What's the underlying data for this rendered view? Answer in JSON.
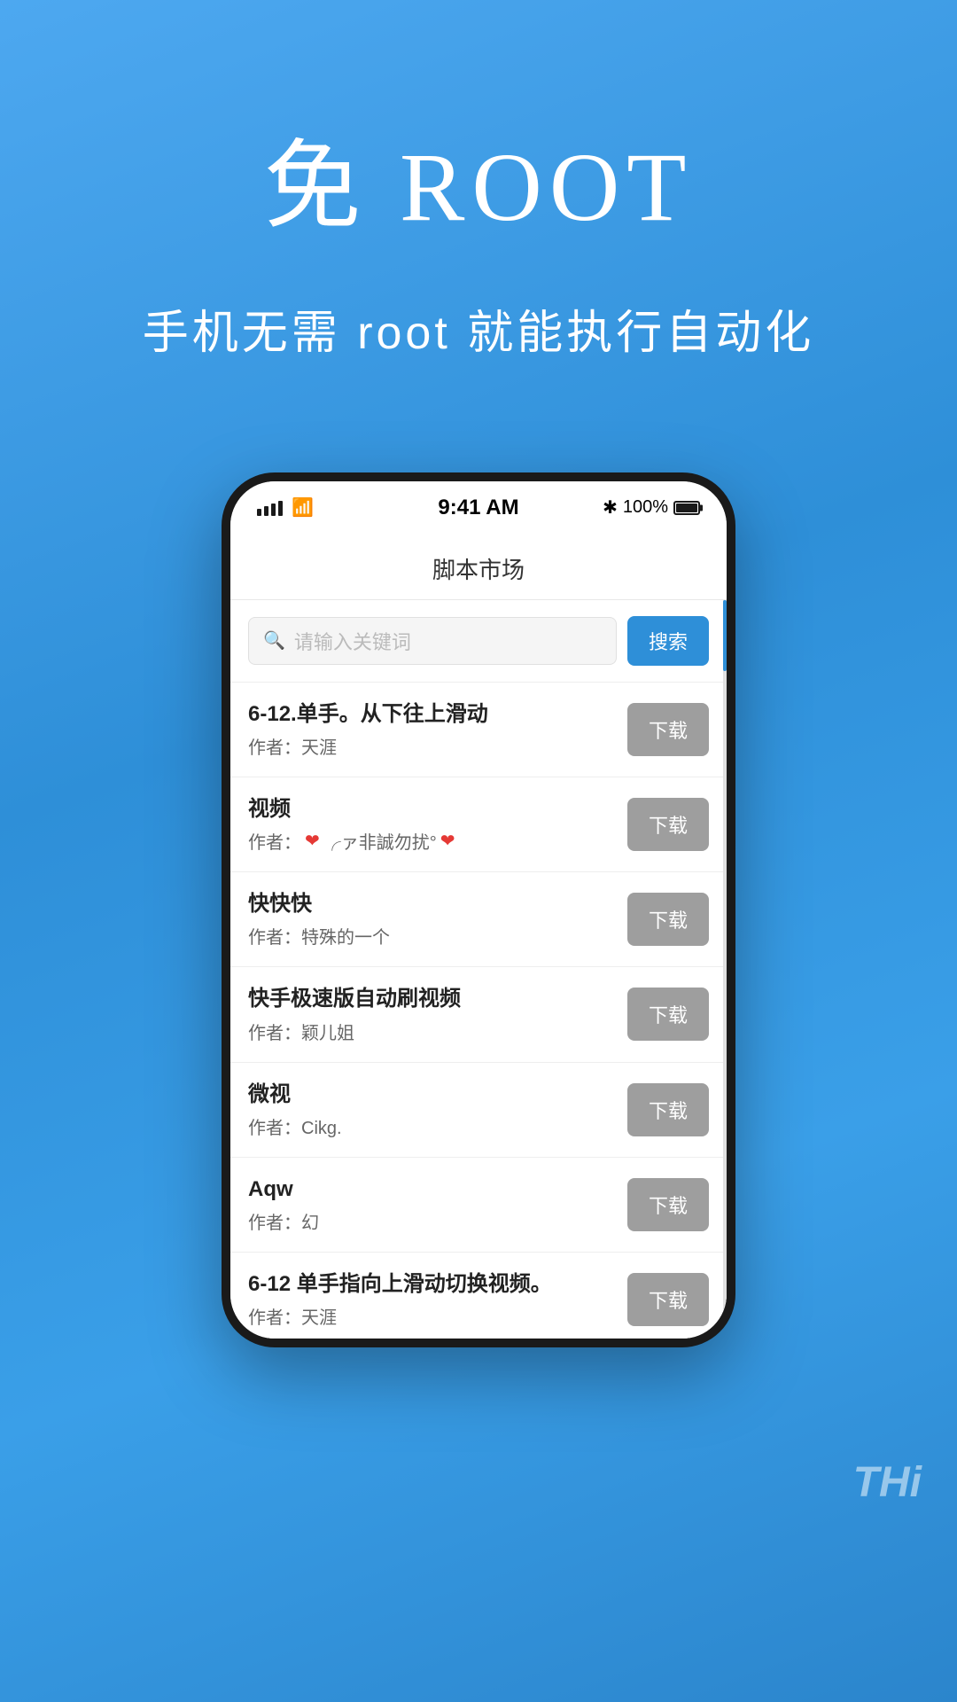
{
  "hero": {
    "title": "免 ROOT",
    "subtitle": "手机无需 root 就能执行自动化"
  },
  "status_bar": {
    "time": "9:41 AM",
    "bluetooth": "✱",
    "battery_percent": "100%"
  },
  "app_header": {
    "title": "脚本市场"
  },
  "search": {
    "placeholder": "请输入关键词",
    "button_label": "搜索"
  },
  "scripts": [
    {
      "name": "6-12.单手。从下往上滑动",
      "author": "作者：天涯",
      "has_hearts": false,
      "download_label": "下载"
    },
    {
      "name": "视频",
      "author": "作者：❤ ╭ァ非誠勿扰°❤",
      "has_hearts": true,
      "download_label": "下载"
    },
    {
      "name": "快快快",
      "author": "作者：特殊的一个",
      "has_hearts": false,
      "download_label": "下载"
    },
    {
      "name": "快手极速版自动刷视频",
      "author": "作者：颖儿姐",
      "has_hearts": false,
      "download_label": "下载"
    },
    {
      "name": "微视",
      "author": "作者：Cikg.",
      "has_hearts": false,
      "download_label": "下载"
    },
    {
      "name": "Aqw",
      "author": "作者：幻",
      "has_hearts": false,
      "download_label": "下载"
    },
    {
      "name": "6-12 单手指向上滑动切换视频。",
      "author": "作者：天涯",
      "has_hearts": false,
      "download_label": "下载"
    }
  ],
  "watermark": {
    "text": "THi"
  }
}
